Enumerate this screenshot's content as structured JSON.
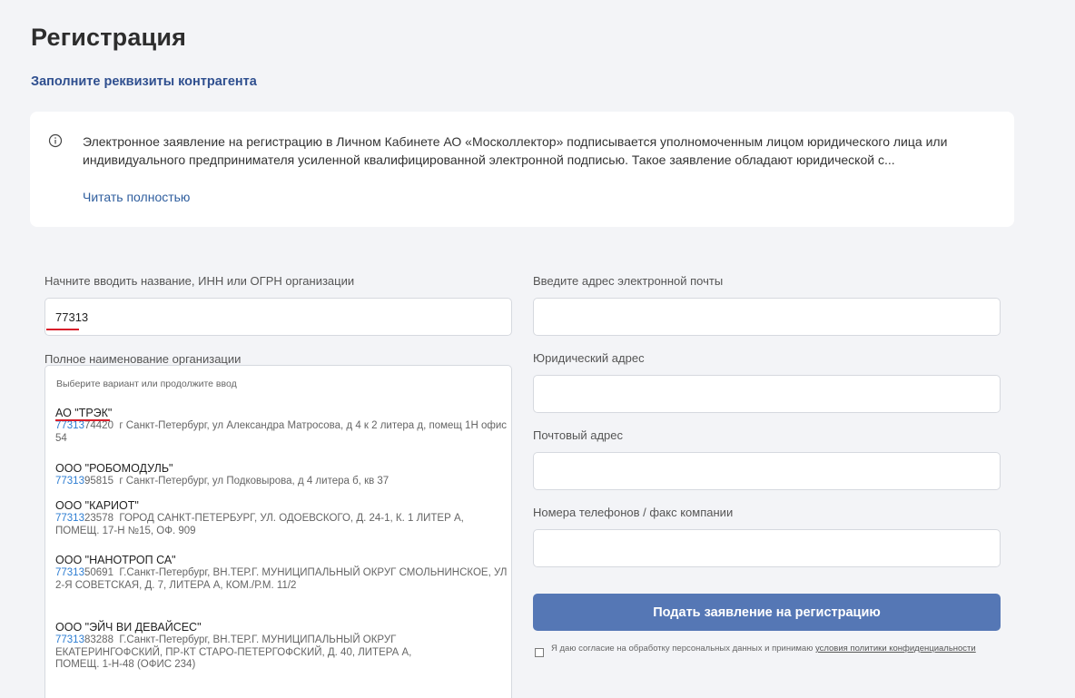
{
  "page": {
    "title": "Регистрация",
    "subtitle": "Заполните реквизиты контрагента"
  },
  "info": {
    "icon": "info-icon",
    "text": "Электронное заявление на регистрацию в Личном Кабинете АО «Москоллектор» подписывается уполномоченным лицом юридического лица или индивидуального предпринимателя усиленной квалифицированной электронной подписью. Такое заявление обладают юридической с...",
    "read_more": "Читать полностью"
  },
  "left": {
    "search_label": "Начните вводить название, ИНН или ОГРН организации",
    "search_value": "77313",
    "full_name_label": "Полное наименование организации"
  },
  "dropdown": {
    "hint": "Выберите вариант или продолжите ввод",
    "items": [
      {
        "name": "АО \"ТРЭК\"",
        "inn_match": "77313",
        "inn_rest": "74420",
        "address": "г Санкт-Петербург, ул Александра Матросова, д 4 к 2 литера д, помещ 1Н офис 54"
      },
      {
        "name": "ООО \"РОБОМОДУЛЬ\"",
        "inn_match": "77313",
        "inn_rest": "95815",
        "address": "г Санкт-Петербург, ул Подковырова, д 4 литера б, кв 37"
      },
      {
        "name": "ООО \"КАРИОТ\"",
        "inn_match": "77313",
        "inn_rest": "23578",
        "address": "ГОРОД САНКТ-ПЕТЕРБУРГ, УЛ. ОДОЕВСКОГО, Д. 24-1, К. 1 ЛИТЕР А, ПОМЕЩ. 17-Н №15, ОФ. 909"
      },
      {
        "name": "ООО \"НАНОТРОП СА\"",
        "inn_match": "77313",
        "inn_rest": "50691",
        "address": "Г.Санкт-Петербург, ВН.ТЕР.Г. МУНИЦИПАЛЬНЫЙ ОКРУГ СМОЛЬНИНСКОЕ, УЛ 2-Я СОВЕТСКАЯ, Д. 7, ЛИТЕРА А, КОМ./Р.М. 11/2"
      },
      {
        "name": "ООО \"ЭЙЧ ВИ ДЕВАЙСЕС\"",
        "inn_match": "77313",
        "inn_rest": "83288",
        "address": "Г.Санкт-Петербург, ВН.ТЕР.Г. МУНИЦИПАЛЬНЫЙ ОКРУГ ЕКАТЕРИНГОФСКИЙ, ПР-КТ СТАРО-ПЕТЕРГОФСКИЙ, Д. 40, ЛИТЕРА А, ПОМЕЩ. 1-Н-48 (ОФИС 234)"
      }
    ]
  },
  "right": {
    "email_label": "Введите адрес электронной почты",
    "legal_address_label": "Юридический адрес",
    "postal_address_label": "Почтовый адрес",
    "phones_label": "Номера телефонов / факс компании",
    "submit_label": "Подать заявление на регистрацию",
    "consent_text": "Я даю согласие на обработку персональных данных и принимаю ",
    "consent_link": "условия политики конфиденциальности"
  },
  "colors": {
    "accent": "#5577b5",
    "link": "#2f5e9e",
    "highlight_underline": "#d81e2a",
    "inn_match": "#2d7dd2"
  }
}
